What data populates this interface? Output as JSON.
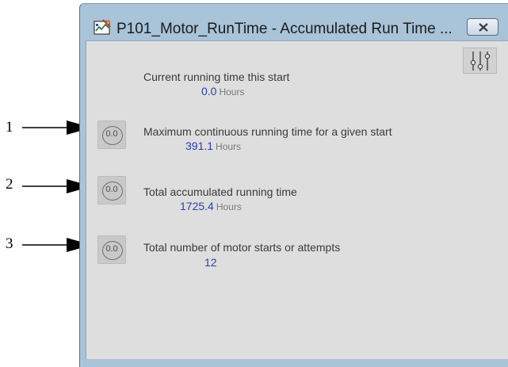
{
  "window": {
    "title": "P101_Motor_RunTime - Accumulated Run Time ...",
    "icons": {
      "app": "faceplate-app-icon",
      "close": "close-icon",
      "settings": "sliders-settings-icon"
    }
  },
  "rows": [
    {
      "label": "Current running time this start",
      "value": "0.0",
      "unit": "Hours",
      "has_reset": false
    },
    {
      "label": "Maximum continuous running time for a given start",
      "value": "391.1",
      "unit": "Hours",
      "has_reset": true,
      "reset_label": "0.0",
      "callout": "1"
    },
    {
      "label": "Total accumulated running time",
      "value": "1725.4",
      "unit": "Hours",
      "has_reset": true,
      "reset_label": "0.0",
      "callout": "2"
    },
    {
      "label": "Total number of motor starts or attempts",
      "value": "12",
      "unit": "",
      "has_reset": true,
      "reset_label": "0.0",
      "callout": "3"
    }
  ],
  "colors": {
    "value_text": "#2b3fae",
    "client_bg": "#dedede",
    "frame": "#a9c3d8"
  }
}
